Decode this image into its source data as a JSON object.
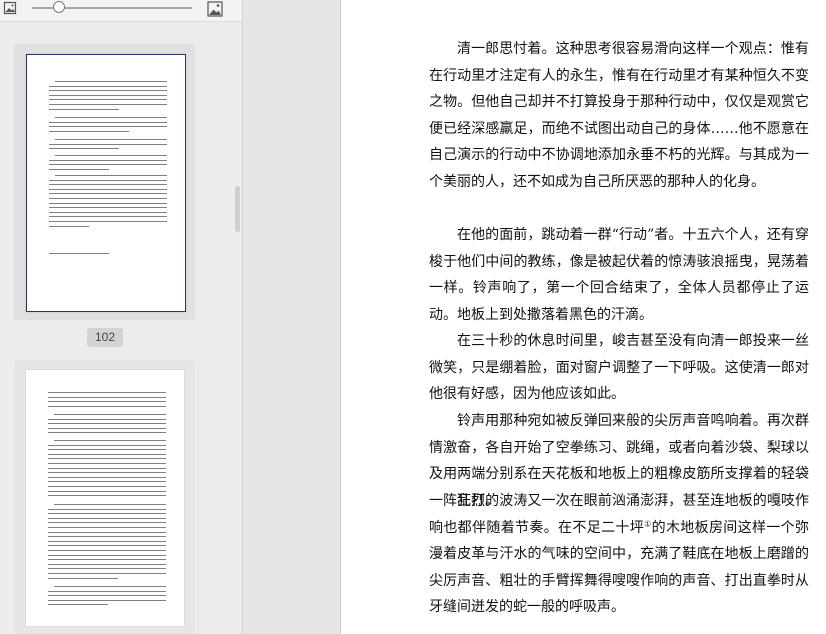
{
  "toolbar": {
    "zoom_out_icon": "image-small-icon",
    "zoom_in_icon": "image-large-icon",
    "zoom_level": 0.17
  },
  "sidebar": {
    "thumbnails": [
      {
        "page_label": "102",
        "selected": true
      },
      {
        "page_label": "",
        "selected": false
      }
    ]
  },
  "document": {
    "paragraphs": [
      {
        "id": "p1",
        "text": "清一郎思忖着。这种思考很容易滑向这样一个观点：惟有在行动里才注定有人的永生，惟有在行动里才有某种恒久不变之物。但他自己却并不打算投身于那种行动中，仅仅是观赏它便已经深感羸足，而绝不试图出动自己的身体……他不愿意在自己演示的行动中不协调地添加永垂不朽的光辉。与其成为一个美丽的人，还不如成为自己所厌恶的那种人的化身。"
      },
      {
        "id": "p2",
        "text": "在他的面前，跳动着一群“行动”者。十五六个人，还有穿梭于他们中间的教练，像是被起伏着的惊涛骇浪摇曳，晃荡着一样。铃声响了，第一个回合结束了，全体人员都停止了运动。地板上到处撒落着黑色的汗滴。"
      },
      {
        "id": "p3",
        "text": "在三十秒的休息时间里，峻吉甚至没有向清一郎投来一丝微笑，只是绷着脸，面对窗户调整了一下呼吸。这使清一郎对他很有好感，因为他应该如此。"
      },
      {
        "id": "p4",
        "text": "铃声用那种宛如被反弹回来般的尖厉声音鸣响着。再次群情激奋，各自开始了空拳练习、跳绳，或者向着沙袋、梨球以及用两端分别系在天花板和地板上的粗橡皮筋所支撑着的轻袋一阵乱打。"
      },
      {
        "id": "p5a",
        "text": "狂烈的波涛又一次在眼前汹涌澎湃，甚至连地板的嘎吱作响也都伴随着节奏。在不足二十坪"
      },
      {
        "id": "p5_note",
        "text": "①"
      },
      {
        "id": "p5b",
        "text": "的木地板房间这样一个弥漫着皮革与汗水的气味的空间中，充满了鞋底在地板上磨蹭的尖厉声音、粗壮的手臂挥舞得嗖嗖作响的声音、打出直拳时从牙缝间迸发的蛇一般的呼吸声。"
      }
    ]
  }
}
